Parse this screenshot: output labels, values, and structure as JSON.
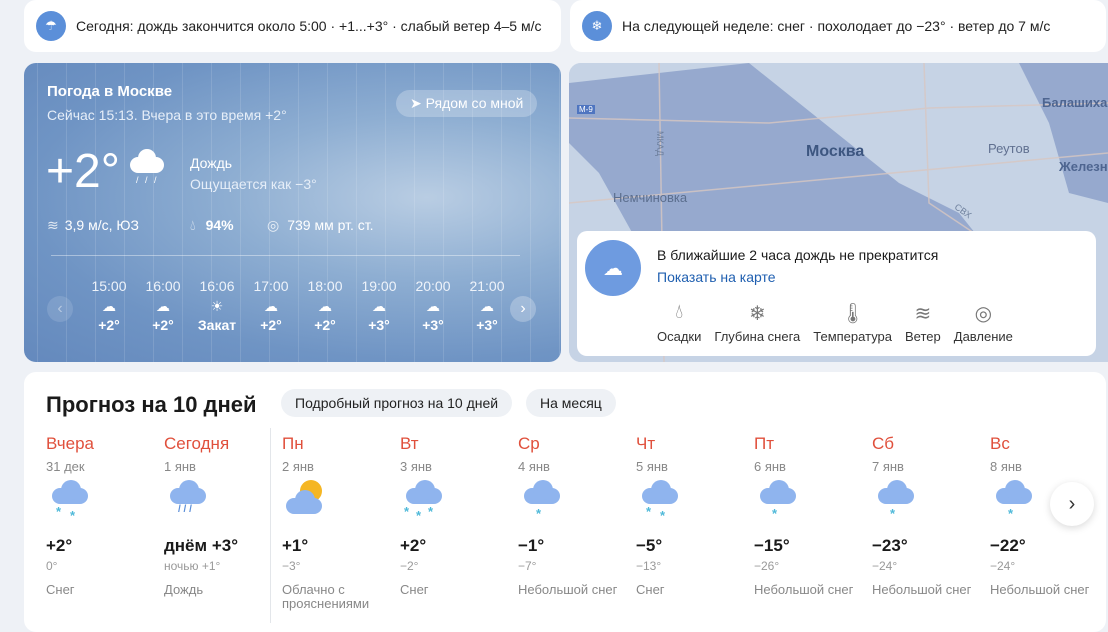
{
  "alerts": [
    {
      "icon": "rain-cloud-icon",
      "text": "Сегодня: дождь закончится около 5:00 · +1...+3° · слабый ветер 4–5 м/с"
    },
    {
      "icon": "snow-cloud-icon",
      "text": "На следующей неделе: снег · похолодает до −23° · ветер до 7 м/с"
    }
  ],
  "now": {
    "title": "Погода в Москве",
    "subtitle": "Сейчас 15:13. Вчера в это время +2°",
    "nearby": "Рядом со мной",
    "temp": "+2°",
    "condition": "Дождь",
    "feels": "Ощущается как −3°",
    "wind": "3,9 м/с, ЮЗ",
    "humidity": "94%",
    "pressure": "739 мм рт. ст.",
    "hours": [
      {
        "time": "15:00",
        "icon": "rain-icon",
        "value": "+2°"
      },
      {
        "time": "16:00",
        "icon": "rain-icon",
        "value": "+2°"
      },
      {
        "time": "16:06",
        "icon": "sunset-icon",
        "value": "Закат"
      },
      {
        "time": "17:00",
        "icon": "rain-icon",
        "value": "+2°"
      },
      {
        "time": "18:00",
        "icon": "rain-icon",
        "value": "+2°"
      },
      {
        "time": "19:00",
        "icon": "rain-icon",
        "value": "+3°"
      },
      {
        "time": "20:00",
        "icon": "rain-icon",
        "value": "+3°"
      },
      {
        "time": "21:00",
        "icon": "rain-icon",
        "value": "+3°"
      }
    ]
  },
  "map": {
    "labels": [
      "Москва",
      "Балашиха",
      "Реутов",
      "Железн",
      "Немчиновка",
      "МКАД",
      "М-9",
      "СВХ"
    ],
    "nowcast": "В ближайшие 2 часа дождь не прекратится",
    "show_on_map": "Показать на карте",
    "layers": [
      "Осадки",
      "Глубина снега",
      "Температура",
      "Ветер",
      "Давление"
    ]
  },
  "forecast": {
    "title": "Прогноз на 10 дней",
    "detailed": "Подробный прогноз на 10 дней",
    "month": "На месяц",
    "days": [
      {
        "name": "Вчера",
        "date": "31 дек",
        "icon": "snow",
        "hi": "+2°",
        "lo": "0°",
        "cond": "Снег"
      },
      {
        "name": "Сегодня",
        "date": "1 янв",
        "icon": "rain",
        "hi": "днём +3°",
        "lo": "ночью +1°",
        "cond": "Дождь"
      },
      {
        "name": "Пн",
        "date": "2 янв",
        "icon": "partly",
        "hi": "+1°",
        "lo": "−3°",
        "cond": "Облачно с прояснениями"
      },
      {
        "name": "Вт",
        "date": "3 янв",
        "icon": "snow3",
        "hi": "+2°",
        "lo": "−2°",
        "cond": "Снег"
      },
      {
        "name": "Ср",
        "date": "4 янв",
        "icon": "snow1",
        "hi": "−1°",
        "lo": "−7°",
        "cond": "Небольшой снег"
      },
      {
        "name": "Чт",
        "date": "5 янв",
        "icon": "snow",
        "hi": "−5°",
        "lo": "−13°",
        "cond": "Снег"
      },
      {
        "name": "Пт",
        "date": "6 янв",
        "icon": "snow1",
        "hi": "−15°",
        "lo": "−26°",
        "cond": "Небольшой снег"
      },
      {
        "name": "Сб",
        "date": "7 янв",
        "icon": "snow1",
        "hi": "−23°",
        "lo": "−24°",
        "cond": "Небольшой снег"
      },
      {
        "name": "Вс",
        "date": "8 янв",
        "icon": "snow1",
        "hi": "−22°",
        "lo": "−24°",
        "cond": "Небольшой снег"
      }
    ]
  },
  "colors": {
    "accent": "#5b8fd9",
    "day_name": "#e0503c",
    "link": "#1f5fb0"
  }
}
